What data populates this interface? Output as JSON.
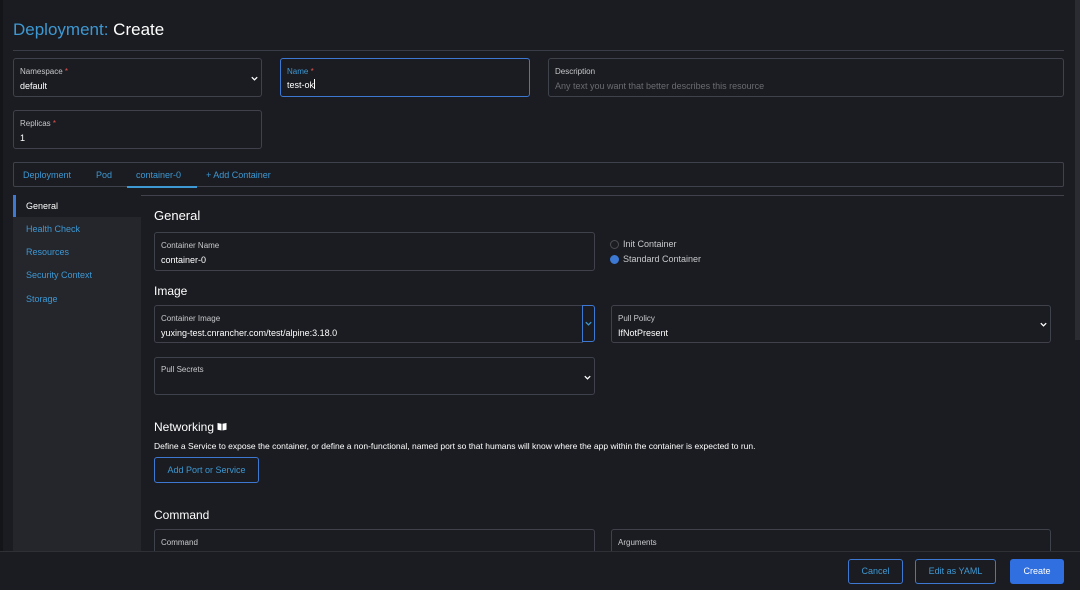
{
  "header": {
    "title_prefix": "Deployment:",
    "title_action": "Create"
  },
  "namespace": {
    "label": "Namespace",
    "required": "*",
    "value": "default"
  },
  "name": {
    "label": "Name",
    "required": "*",
    "value": "test-ok"
  },
  "description": {
    "label": "Description",
    "placeholder": "Any text you want that better describes this resource"
  },
  "replicas": {
    "label": "Replicas",
    "required": "*",
    "value": "1"
  },
  "tabs": [
    {
      "label": "Deployment"
    },
    {
      "label": "Pod"
    },
    {
      "label": "container-0"
    },
    {
      "label": "+ Add Container"
    }
  ],
  "sidenav": [
    {
      "label": "General"
    },
    {
      "label": "Health Check"
    },
    {
      "label": "Resources"
    },
    {
      "label": "Security Context"
    },
    {
      "label": "Storage"
    }
  ],
  "general": {
    "title": "General",
    "container_name": {
      "label": "Container Name",
      "value": "container-0"
    },
    "radio_init": "Init Container",
    "radio_standard": "Standard Container"
  },
  "image": {
    "title": "Image",
    "container_image": {
      "label": "Container Image",
      "value": "yuxing-test.cnrancher.com/test/alpine:3.18.0"
    },
    "pull_policy": {
      "label": "Pull Policy",
      "value": "IfNotPresent"
    },
    "pull_secrets": {
      "label": "Pull Secrets"
    }
  },
  "networking": {
    "title": "Networking",
    "description": "Define a Service to expose the container, or define a non-functional, named port so that humans will know where the app within the container is expected to run.",
    "add_button": "Add Port or Service"
  },
  "command": {
    "title": "Command",
    "command_label": "Command",
    "arguments_label": "Arguments"
  },
  "footer": {
    "cancel": "Cancel",
    "edit_yaml": "Edit as YAML",
    "create": "Create"
  },
  "colors": {
    "accent": "#3d98d3",
    "primary": "#2f6fe0",
    "background": "#1b1c21",
    "required": "#e0514c"
  }
}
